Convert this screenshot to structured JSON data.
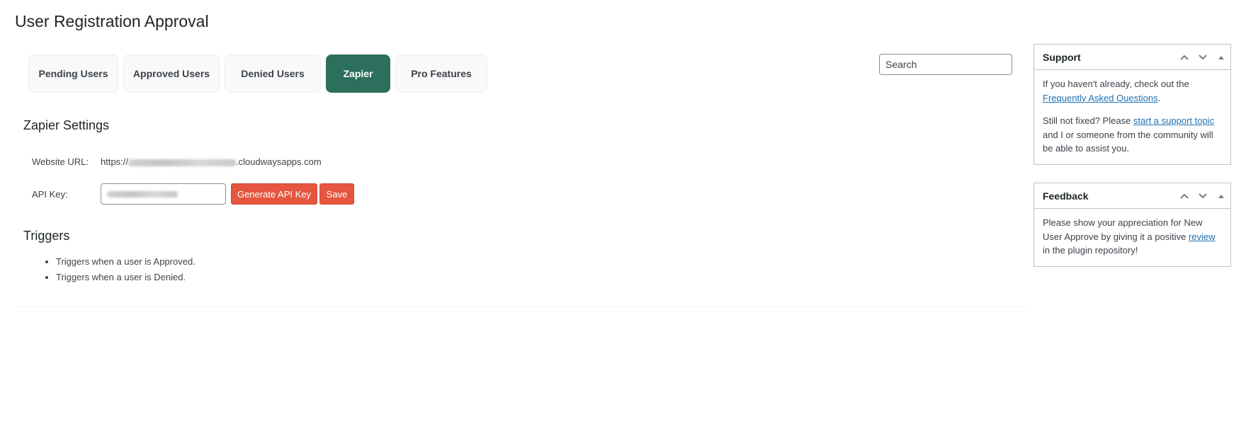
{
  "page": {
    "title": "User Registration Approval"
  },
  "tabs": [
    {
      "label": "Pending Users"
    },
    {
      "label": "Approved Users"
    },
    {
      "label": "Denied Users"
    },
    {
      "label": "Zapier",
      "active": true
    },
    {
      "label": "Pro Features"
    }
  ],
  "search": {
    "placeholder": "Search"
  },
  "zapier": {
    "title": "Zapier Settings",
    "website_url_label": "Website URL:",
    "url_prefix": "https://",
    "url_suffix": ".cloudwaysapps.com",
    "api_key_label": "API Key:",
    "generate_button": "Generate API Key",
    "save_button": "Save"
  },
  "triggers": {
    "title": "Triggers",
    "items": [
      "Triggers when a user is Approved.",
      "Triggers when a user is Denied."
    ]
  },
  "support": {
    "title": "Support",
    "p1_text": "If you haven't already, check out the ",
    "p1_link": "Frequently Asked Questions",
    "p1_end": ".",
    "p2_text": "Still not fixed? Please ",
    "p2_link": "start a support topic",
    "p2_end": " and I or someone from the community will be able to assist you."
  },
  "feedback": {
    "title": "Feedback",
    "text": "Please show your appreciation for New User Approve by giving it a positive ",
    "link": "review",
    "end": " in the plugin repository!"
  },
  "colors": {
    "active_tab": "#2b6f5c",
    "button": "#e5553f",
    "link": "#2271b1"
  },
  "icons": [
    "chevron-up-icon",
    "chevron-down-icon",
    "triangle-up-icon"
  ]
}
